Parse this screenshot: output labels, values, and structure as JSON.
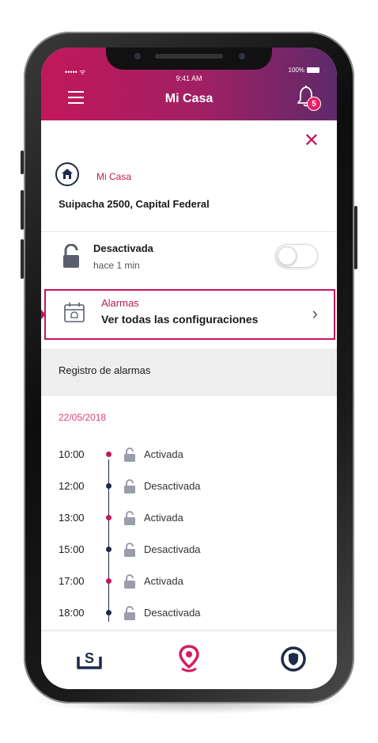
{
  "status_bar": {
    "signal": "••••• ᯤ",
    "time": "9:41 AM",
    "battery": "100%"
  },
  "header": {
    "title": "Mi Casa",
    "notification_count": "5"
  },
  "property": {
    "name": "Mi Casa",
    "address": "Suipacha 2500, Capital Federal"
  },
  "alarm_state": {
    "label": "Desactivada",
    "time": "hace 1 min",
    "enabled": false
  },
  "alarms_card": {
    "title": "Alarmas",
    "subtitle": "Ver todas las configuraciones",
    "chevron": "›"
  },
  "log": {
    "section_title": "Registro de alarmas",
    "date": "22/05/2018",
    "entries": [
      {
        "time": "10:00",
        "status": "Activada",
        "active": true
      },
      {
        "time": "12:00",
        "status": "Desactivada",
        "active": false
      },
      {
        "time": "13:00",
        "status": "Activada",
        "active": true
      },
      {
        "time": "15:00",
        "status": "Desactivada",
        "active": false
      },
      {
        "time": "17:00",
        "status": "Activada",
        "active": true
      },
      {
        "time": "18:00",
        "status": "Desactivada",
        "active": false
      }
    ]
  },
  "bottom_nav": {
    "items": [
      "payments-icon",
      "location-pin-icon",
      "security-shield-icon"
    ],
    "active": "location-pin-icon"
  },
  "colors": {
    "accent": "#c2185b",
    "navy": "#1e2a4a",
    "header_end": "#5e2a6a"
  }
}
